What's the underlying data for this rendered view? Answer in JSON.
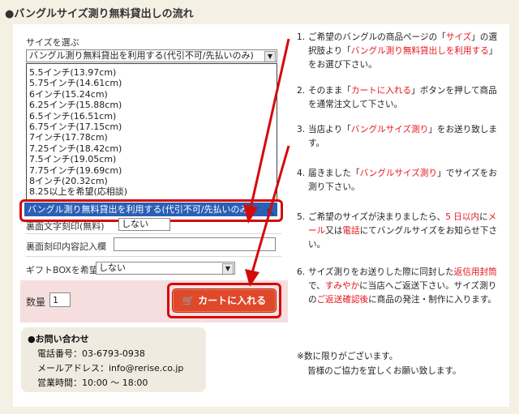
{
  "title": "●バングルサイズ測り無料貸出しの流れ",
  "form": {
    "size_label": "サイズを選ぶ",
    "size_selected": "バングル測り無料貸出を利用する(代引不可/先払いのみ)",
    "size_options": [
      "5.5インチ(13.97cm)",
      "5.75インチ(14.61cm)",
      "6インチ(15.24cm)",
      "6.25インチ(15.88cm)",
      "6.5インチ(16.51cm)",
      "6.75インチ(17.15cm)",
      "7インチ(17.78cm)",
      "7.25インチ(18.42cm)",
      "7.5インチ(19.05cm)",
      "7.75インチ(19.69cm)",
      "8インチ(20.32cm)",
      "8.25以上を希望(応相談)"
    ],
    "highlighted_option": "バングル測り無料貸出を利用する(代引不可/先払いのみ)",
    "engrave_label": "裏面文字刻印(無料)",
    "engrave_value": "しない",
    "engrave_text_label": "裏面刻印内容記入欄",
    "engrave_text_value": "",
    "gift_label": "ギフトBOXを希望",
    "gift_value": "しない",
    "qty_label": "数量",
    "qty_value": "1",
    "cart_button": "カートに入れる"
  },
  "contact": {
    "heading": "●お問い合わせ",
    "phone": "電話番号：03-6793-0938",
    "email": "メールアドレス：info@rerise.co.jp",
    "hours": "営業時間：10:00 ～ 18:00"
  },
  "steps": [
    {
      "num": "1.",
      "parts": [
        {
          "t": "ご希望のバングルの商品ページの「"
        },
        {
          "t": "サイズ",
          "red": true
        },
        {
          "t": "」の選択肢より「"
        },
        {
          "t": "バングル測り無料貸出しを利用する",
          "red": true
        },
        {
          "t": "」をお選び下さい。"
        }
      ]
    },
    {
      "num": "2.",
      "parts": [
        {
          "t": "そのまま「"
        },
        {
          "t": "カートに入れる",
          "red": true
        },
        {
          "t": "」ボタンを押して商品を通常注文して下さい。"
        }
      ]
    },
    {
      "num": "3.",
      "parts": [
        {
          "t": "当店より「"
        },
        {
          "t": "バングルサイズ測り",
          "red": true
        },
        {
          "t": "」をお送り致します。"
        }
      ]
    },
    {
      "num": "4.",
      "parts": [
        {
          "t": "届きました「"
        },
        {
          "t": "バングルサイズ測り",
          "red": true
        },
        {
          "t": "」でサイズをお測り下さい。"
        }
      ]
    },
    {
      "num": "5.",
      "parts": [
        {
          "t": "ご希望のサイズが決まりましたら、"
        },
        {
          "t": "5 日以内",
          "red": true
        },
        {
          "t": "に"
        },
        {
          "t": "メール",
          "red": true
        },
        {
          "t": "又は"
        },
        {
          "t": "電話",
          "red": true
        },
        {
          "t": "にてバングルサイズをお知らせ下さい。"
        }
      ]
    },
    {
      "num": "6.",
      "parts": [
        {
          "t": "サイズ測りをお送りした際に同封した"
        },
        {
          "t": "返信用封筒",
          "red": true
        },
        {
          "t": "で、"
        },
        {
          "t": "すみやか",
          "red": true
        },
        {
          "t": "に当店へご返送下さい。サイズ測りの"
        },
        {
          "t": "ご返送確認後",
          "red": true
        },
        {
          "t": "に商品の発注・制作に入ります。"
        }
      ]
    }
  ],
  "note1": "※数に限りがございます。",
  "note2": "皆様のご協力を宜しくお願い致します。",
  "colors": {
    "accent_red": "#e5141d",
    "cart": "#e0482a",
    "highlight": "#2a5fb5"
  }
}
